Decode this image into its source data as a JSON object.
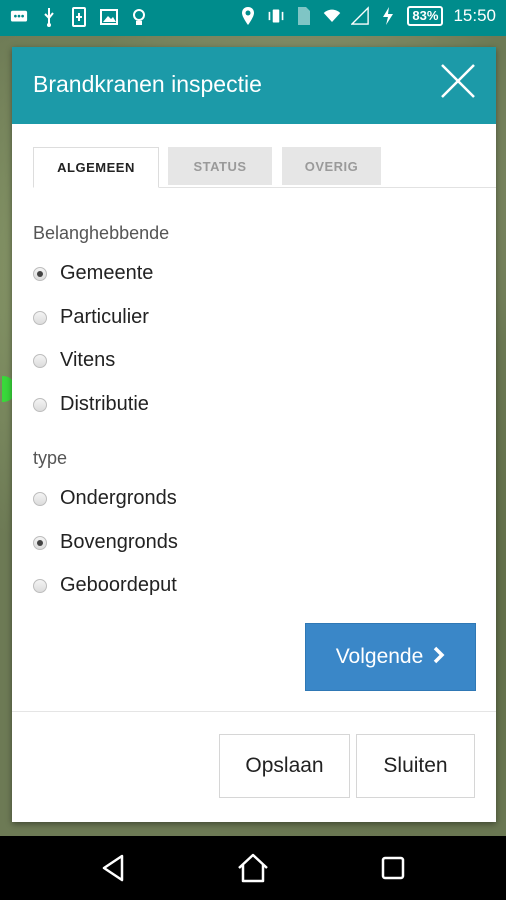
{
  "status_bar": {
    "battery": "83%",
    "time": "15:50"
  },
  "dialog": {
    "title": "Brandkranen inspectie",
    "tabs": [
      {
        "label": "ALGEMEEN",
        "active": true
      },
      {
        "label": "STATUS",
        "active": false
      },
      {
        "label": "OVERIG",
        "active": false
      }
    ],
    "groups": {
      "belanghebbende": {
        "label": "Belanghebbende",
        "options": [
          {
            "label": "Gemeente",
            "checked": true
          },
          {
            "label": "Particulier",
            "checked": false
          },
          {
            "label": "Vitens",
            "checked": false
          },
          {
            "label": "Distributie",
            "checked": false
          }
        ]
      },
      "type": {
        "label": "type",
        "options": [
          {
            "label": "Ondergronds",
            "checked": false
          },
          {
            "label": "Bovengronds",
            "checked": true
          },
          {
            "label": "Geboordeput",
            "checked": false
          }
        ]
      }
    },
    "next_label": "Volgende",
    "save_label": "Opslaan",
    "close_label": "Sluiten"
  },
  "colors": {
    "header": "#1c9aa8",
    "status_bar": "#008c8c",
    "primary_button": "#3a87c8"
  }
}
